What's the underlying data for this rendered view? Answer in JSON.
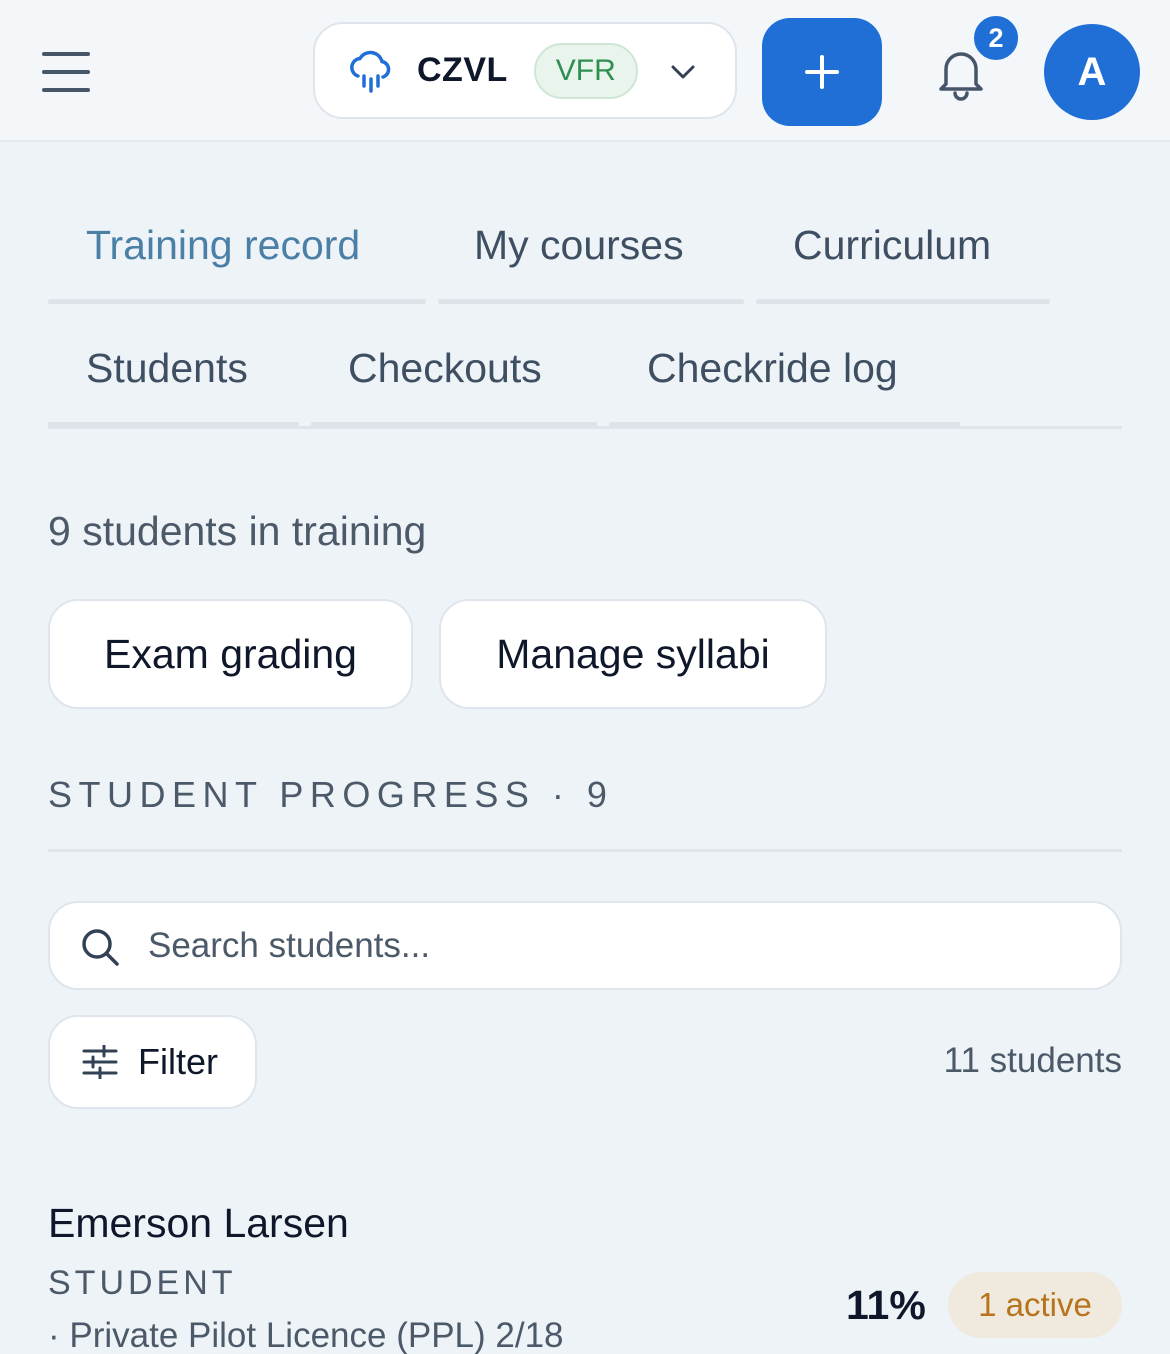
{
  "header": {
    "station_code": "CZVL",
    "flight_rules": "VFR",
    "notification_count": "2",
    "avatar_initial": "A",
    "icons": {
      "menu": "hamburger-icon",
      "weather": "rain-cloud-icon",
      "dropdown": "chevron-down-icon",
      "add": "plus-icon",
      "notifications": "bell-icon"
    },
    "colors": {
      "accent": "#1f6fd6",
      "vfr_green": "#2f8f51"
    }
  },
  "tabs": [
    {
      "label": "Training record",
      "active": true
    },
    {
      "label": "My courses",
      "active": false
    },
    {
      "label": "Curriculum",
      "active": false
    },
    {
      "label": "Students",
      "active": false
    },
    {
      "label": "Checkouts",
      "active": false
    },
    {
      "label": "Checkride log",
      "active": false
    }
  ],
  "summary": {
    "students_in_training": "9 students in training"
  },
  "actions": {
    "exam_grading": "Exam grading",
    "manage_syllabi": "Manage syllabi"
  },
  "progress": {
    "heading": "STUDENT PROGRESS · 9",
    "search_placeholder": "Search students...",
    "filter_label": "Filter",
    "student_count": "11 students"
  },
  "students": [
    {
      "name": "Emerson Larsen",
      "role": "STUDENT",
      "course": "· Private Pilot Licence (PPL) 2/18",
      "progress": "11%",
      "status": "1 active"
    }
  ]
}
